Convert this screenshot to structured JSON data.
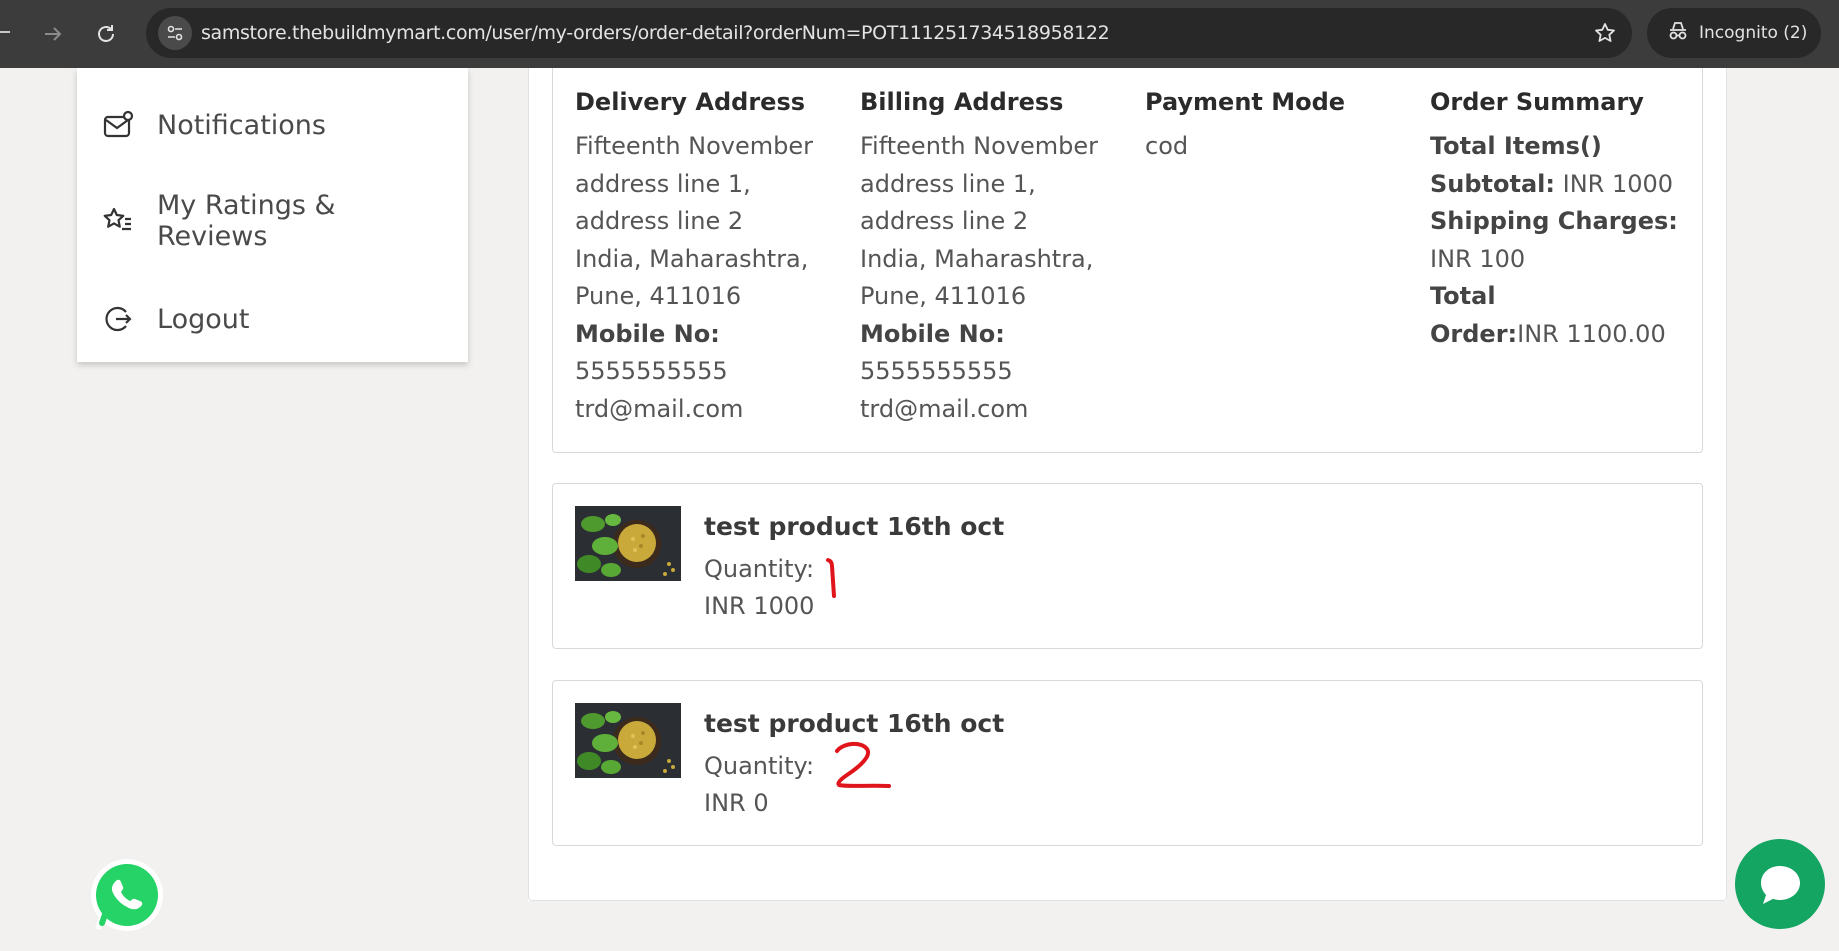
{
  "browser": {
    "url": "samstore.thebuildmymart.com/user/my-orders/order-detail?orderNum=POT111251734518958122",
    "incognito_label": "Incognito (2)"
  },
  "sidebar": {
    "items": [
      {
        "label": "Notifications",
        "icon": "mail-badge-icon"
      },
      {
        "label": "My Ratings & Reviews",
        "icon": "star-list-icon"
      },
      {
        "label": "Logout",
        "icon": "logout-icon"
      }
    ]
  },
  "order": {
    "delivery": {
      "heading": "Delivery Address",
      "lines": [
        "Fifteenth November",
        "address line 1,",
        "address line 2",
        "India, Maharashtra,",
        "Pune, 411016"
      ],
      "mobile_label": "Mobile No:",
      "mobile": "5555555555",
      "email": "trd@mail.com"
    },
    "billing": {
      "heading": "Billing Address",
      "lines": [
        "Fifteenth November",
        "address line 1,",
        "address line 2",
        "India, Maharashtra,",
        "Pune, 411016"
      ],
      "mobile_label": "Mobile No:",
      "mobile": "5555555555",
      "email": "trd@mail.com"
    },
    "payment": {
      "heading": "Payment Mode",
      "value": "cod"
    },
    "summary": {
      "heading": "Order Summary",
      "total_items": "Total Items()",
      "subtotal_label": "Subtotal:",
      "subtotal_value": " INR 1000",
      "shipping_label": "Shipping Charges:",
      "shipping_value": "INR 100",
      "total_label_1": "Total",
      "total_label_2": "Order:",
      "total_value": "INR 1100.00"
    }
  },
  "products": [
    {
      "name": "test product 16th oct",
      "quantity_label": "Quantity:",
      "quantity_annotation": "1",
      "price": "INR 1000"
    },
    {
      "name": "test product 16th oct",
      "quantity_label": "Quantity:",
      "quantity_annotation": "2",
      "price": "INR 0"
    }
  ],
  "colors": {
    "chrome": "#3c3c3c",
    "whatsapp": "#25d366",
    "chat": "#13a561",
    "annotation": "#e0151b"
  }
}
